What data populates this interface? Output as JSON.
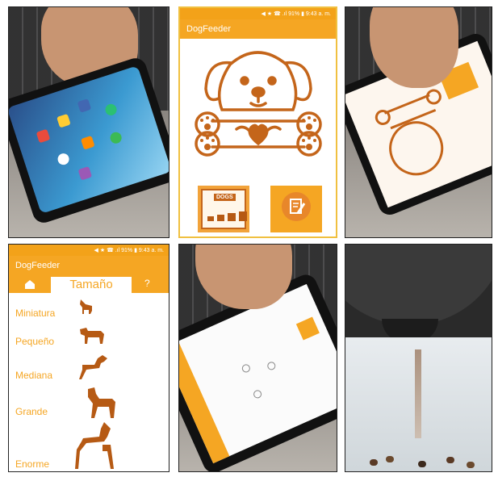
{
  "main_app": {
    "status_left": "",
    "status_right": "◀ ★ ☎ .ıl 91% ▮ 9:43 a. m.",
    "app_title": "DogFeeder",
    "dogs_button_text": "DOGS"
  },
  "size_app": {
    "status_right": "◀ ★ ☎ .ıl 91% ▮ 9:43 a. m.",
    "app_title": "DogFeeder",
    "tab_title": "Tamaño",
    "help_label": "?",
    "sizes": [
      "Miniatura",
      "Pequeño",
      "Mediana",
      "Grande",
      "Enorme"
    ]
  },
  "colors": {
    "accent": "#f5a623",
    "brown": "#b65a14"
  }
}
